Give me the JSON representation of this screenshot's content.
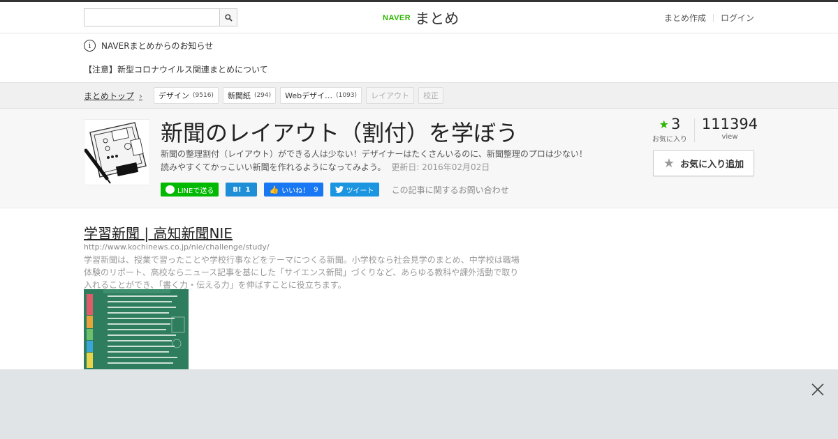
{
  "header": {
    "search": {
      "value": "",
      "placeholder": ""
    },
    "logo": {
      "naver": "NAVER",
      "matome": "まとめ"
    },
    "links": {
      "create": "まとめ作成",
      "login": "ログイン"
    }
  },
  "notice": {
    "label": "NAVERまとめからのお知らせ",
    "link": "【注意】新型コロナウイルス関連まとめについて"
  },
  "breadcrumb": {
    "home": "まとめトップ",
    "tags": [
      {
        "label": "デザイン",
        "count": "(9516)"
      },
      {
        "label": "新聞紙",
        "count": "(294)"
      },
      {
        "label": "Webデザイ…",
        "count": "(1093)"
      },
      {
        "label": "レイアウト",
        "count": ""
      },
      {
        "label": "校正",
        "count": ""
      }
    ]
  },
  "article": {
    "title": "新聞のレイアウト（割付）を学ぼう",
    "desc_line1": "新聞の整理割付（レイアウト）ができる人は少ない！デザイナーはたくさんいるのに、新聞整理のプロは少ない！",
    "desc_line2": "読みやすくてかっこいい新聞を作れるようになってみよう。",
    "updated": "更新日: 2016年02月02日",
    "share": {
      "line": "LINEで送る",
      "hatena_label": "B!",
      "hatena_count": "1",
      "fb_label": "いいね！",
      "fb_count": "9",
      "tweet": "ツイート"
    },
    "contact": "この記事に関するお問い合わせ",
    "stats": {
      "favorites": "3",
      "favorites_label": "お気に入り",
      "views": "111394",
      "views_label": "view"
    },
    "fav_button": "お気に入り追加"
  },
  "item": {
    "title": "学習新聞 | 高知新聞NIE",
    "url": "http://www.kochinews.co.jp/nie/challenge/study/",
    "description": "学習新聞は、授業で習ったことや学校行事などをテーマにつくる新聞。小学校なら社会見学のまとめ、中学校は職場体験のリポート、高校ならニュース記事を基にした「サイエンス新聞」づくりなど、あらゆる教科や課外活動で取り入れることができ、「書く力・伝える力」を伸ばすことに役立ちます。"
  },
  "colors": {
    "naver_green": "#2db400",
    "line_green": "#00b900",
    "hatena_blue": "#1e8fd6",
    "facebook_blue": "#1877f2",
    "twitter_blue": "#1b95e0",
    "overlay_gray": "#e1e4e7"
  },
  "icons": {
    "search": "search-icon",
    "notice": "info-icon",
    "close": "close-icon",
    "star": "star-icon"
  }
}
